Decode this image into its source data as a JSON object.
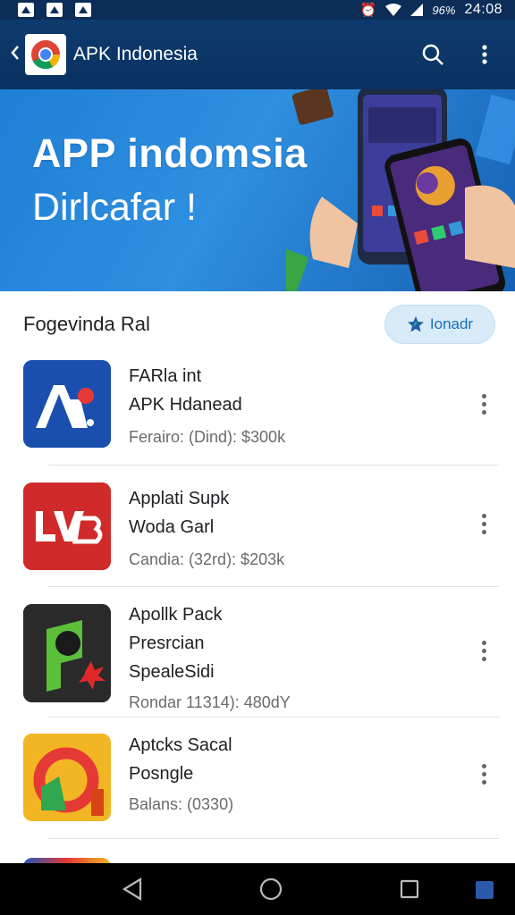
{
  "status_bar": {
    "battery_text": "96%",
    "time": "24:08"
  },
  "app_bar": {
    "title": "APK Indonesia"
  },
  "banner": {
    "title": "APP indomsia",
    "subtitle": "Dirlcafar !"
  },
  "section": {
    "title": "Fogevinda Ral",
    "button_label": "Ionadr"
  },
  "apps": [
    {
      "lines": [
        "FARla int",
        "APK Hdanead"
      ],
      "meta": "Ferairo: (Dind): $300k"
    },
    {
      "lines": [
        "Applati Supk",
        "Woda Garl"
      ],
      "meta": "Candia: (32rd): $203k"
    },
    {
      "lines": [
        "Apollk Pack",
        "Presrcian",
        "SpealeSidi"
      ],
      "meta": "Rondar 11314): 480dY"
    },
    {
      "lines": [
        "Aptcks Sacal",
        "Posngle"
      ],
      "meta": "Balans: (0330)"
    }
  ],
  "colors": {
    "app_bar": "#0d3a6c",
    "banner": "#2f8fe0",
    "accent": "#1a6fb8"
  },
  "icons": {
    "back": "chevron-left-icon",
    "logo": "chrome-logo",
    "search": "search-icon",
    "more": "more-vertical-icon",
    "nav_back": "triangle-back-icon",
    "nav_home": "circle-home-icon",
    "nav_recents": "square-recents-icon"
  }
}
